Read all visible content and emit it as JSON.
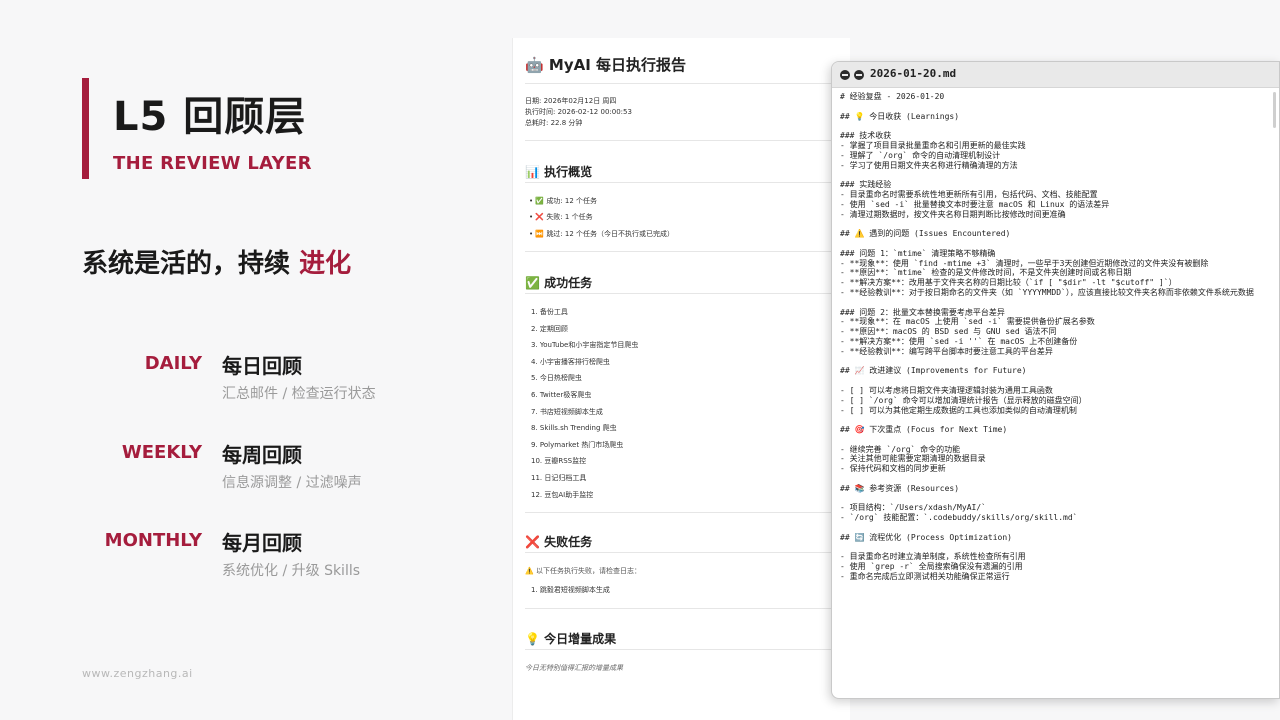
{
  "slide": {
    "title": "L5 回顾层",
    "subtitle": "THE REVIEW LAYER",
    "tagline_prefix": "系统是活的，持续 ",
    "tagline_highlight": "进化",
    "cadences": [
      {
        "key": "DAILY",
        "title": "每日回顾",
        "desc": "汇总邮件 / 检查运行状态"
      },
      {
        "key": "WEEKLY",
        "title": "每周回顾",
        "desc": "信息源调整 / 过滤噪声"
      },
      {
        "key": "MONTHLY",
        "title": "每月回顾",
        "desc": "系统优化 / 升级 Skills"
      }
    ],
    "footer_url": "www.zengzhang.ai",
    "accent_color": "#a51d3d"
  },
  "report": {
    "title_icon": "🤖",
    "title": "MyAI 每日执行报告",
    "meta": [
      "日期: 2026年02月12日 周四",
      "执行时间: 2026-02-12 00:00:53",
      "总耗时: 22.8 分钟"
    ],
    "overview": {
      "icon": "📊",
      "heading": "执行概览",
      "items": [
        {
          "icon": "✅",
          "text": "成功: 12 个任务"
        },
        {
          "icon": "❌",
          "text": "失败: 1 个任务"
        },
        {
          "icon": "⏭️",
          "text": "跳过: 12 个任务（今日不执行或已完成）"
        }
      ]
    },
    "success": {
      "icon": "✅",
      "heading": "成功任务",
      "items": [
        "1. 备份工具",
        "2. 定期回顾",
        "3. YouTube和小宇宙指定节目爬虫",
        "4. 小宇宙播客排行榜爬虫",
        "5. 今日热榜爬虫",
        "6. Twitter极客爬虫",
        "7. 书店短视频脚本生成",
        "8. Skills.sh Trending 爬虫",
        "9. Polymarket 热门市场爬虫",
        "10. 豆瓣RSS监控",
        "11. 日记归档工具",
        "12. 豆包AI助手监控"
      ]
    },
    "failed": {
      "icon": "❌",
      "heading": "失败任务",
      "note": "⚠️ 以下任务执行失败，请检查日志：",
      "items": [
        "1. 跳毅君短视频脚本生成"
      ]
    },
    "gains": {
      "icon": "💡",
      "heading": "今日增量成果",
      "note": "今日无特别值得汇报的增量成果"
    }
  },
  "terminal": {
    "title": "2026-01-20.md",
    "lines": [
      "# 经验复盘 - 2026-01-20",
      "",
      "## 💡 今日收获 (Learnings)",
      "",
      "### 技术收获",
      "- 掌握了项目目录批量重命名和引用更新的最佳实践",
      "- 理解了 `/org` 命令的自动清理机制设计",
      "- 学习了使用日期文件夹名称进行精确清理的方法",
      "",
      "### 实践经验",
      "- 目录重命名时需要系统性地更新所有引用，包括代码、文档、技能配置",
      "- 使用 `sed -i` 批量替换文本时要注意 macOS 和 Linux 的语法差异",
      "- 清理过期数据时，按文件夹名称日期判断比按修改时间更准确",
      "",
      "## ⚠️ 遇到的问题 (Issues Encountered)",
      "",
      "### 问题 1：`mtime` 清理策略不够精确",
      "- **现象**：使用 `find -mtime +3` 清理时，一些早于3天创建但近期修改过的文件夹没有被删除",
      "- **原因**：`mtime` 检查的是文件修改时间，不是文件夹创建时间或名称日期",
      "- **解决方案**：改用基于文件夹名称的日期比较（`if [ \"$dir\" -lt \"$cutoff\" ]`）",
      "- **经验教训**：对于按日期命名的文件夹（如 `YYYYMMDD`），应该直接比较文件夹名称而非依赖文件系统元数据",
      "",
      "### 问题 2：批量文本替换需要考虑平台差异",
      "- **现象**：在 macOS 上使用 `sed -i` 需要提供备份扩展名参数",
      "- **原因**：macOS 的 BSD sed 与 GNU sed 语法不同",
      "- **解决方案**：使用 `sed -i ''` 在 macOS 上不创建备份",
      "- **经验教训**：编写跨平台脚本时要注意工具的平台差异",
      "",
      "## 📈 改进建议 (Improvements for Future)",
      "",
      "- [ ] 可以考虑将日期文件夹清理逻辑封装为通用工具函数",
      "- [ ] `/org` 命令可以增加清理统计报告（显示释放的磁盘空间）",
      "- [ ] 可以为其他定期生成数据的工具也添加类似的自动清理机制",
      "",
      "## 🎯 下次重点 (Focus for Next Time)",
      "",
      "- 继续完善 `/org` 命令的功能",
      "- 关注其他可能需要定期清理的数据目录",
      "- 保持代码和文档的同步更新",
      "",
      "## 📚 参考资源 (Resources)",
      "",
      "- 项目结构：`/Users/xdash/MyAI/`",
      "- `/org` 技能配置：`.codebuddy/skills/org/skill.md`",
      "",
      "## 🔄 流程优化 (Process Optimization)",
      "",
      "- 目录重命名时建立清单制度，系统性检查所有引用",
      "- 使用 `grep -r` 全局搜索确保没有遗漏的引用",
      "- 重命名完成后立即测试相关功能确保正常运行"
    ]
  }
}
